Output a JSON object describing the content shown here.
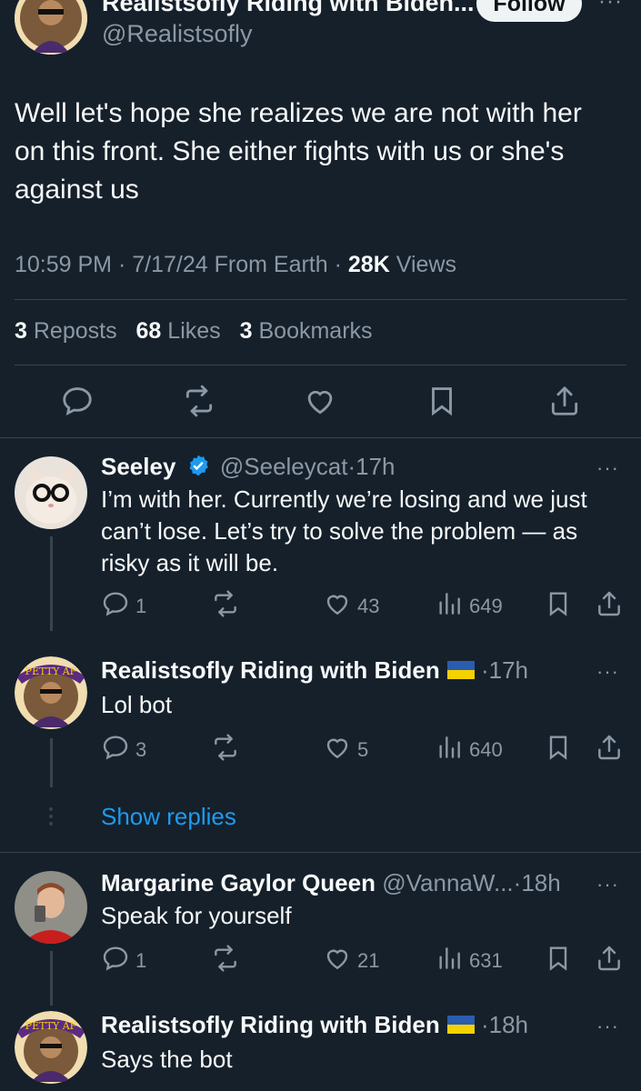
{
  "main_tweet": {
    "author_name": "Realistsofly Riding with Biden...",
    "handle": "@Realistsofly",
    "follow_label": "Follow",
    "text": "Well let's hope she realizes we are not with her on this front. She either fights with us or she's against us",
    "time": "10:59 PM",
    "date": "7/17/24",
    "location": "From Earth",
    "views_count": "28K",
    "views_label": "Views",
    "reposts_count": "3",
    "reposts_label": "Reposts",
    "likes_count": "68",
    "likes_label": "Likes",
    "bookmarks_count": "3",
    "bookmarks_label": "Bookmarks",
    "sep": "·"
  },
  "icons": {
    "reply": "reply-icon",
    "repost": "repost-icon",
    "like": "heart-icon",
    "views": "views-icon",
    "bookmark": "bookmark-icon",
    "share": "share-icon",
    "verified": "verified-badge-icon",
    "flag": "ukraine-flag-icon"
  },
  "colors": {
    "background": "#15202b",
    "text": "#f7f9f9",
    "muted": "#8b98a5",
    "accent": "#1d9bf0",
    "divider": "#38444d"
  },
  "replies": [
    {
      "name": "Seeley",
      "handle": "@Seeleycat",
      "time": "17h",
      "text": "I’m with her. Currently we’re losing and we just can’t lose.  Let’s try to solve the problem — as risky as it will be.",
      "replies": "1",
      "reposts": "",
      "likes": "43",
      "views": "649"
    },
    {
      "name": "Realistsofly Riding with Biden",
      "handle": "",
      "time": "17h",
      "avatar_text": "PETTY AF",
      "text": "Lol bot",
      "replies": "3",
      "reposts": "",
      "likes": "5",
      "views": "640"
    },
    {
      "name": "Margarine Gaylor Queen",
      "handle": "@VannaW...",
      "time": "18h",
      "text": "Speak for yourself",
      "replies": "1",
      "reposts": "",
      "likes": "21",
      "views": "631"
    },
    {
      "name": "Realistsofly Riding with Biden",
      "handle": "",
      "time": "18h",
      "avatar_text": "PETTY AF",
      "text": "Says the bot"
    }
  ],
  "show_replies_label": "Show replies",
  "more_label": "···"
}
